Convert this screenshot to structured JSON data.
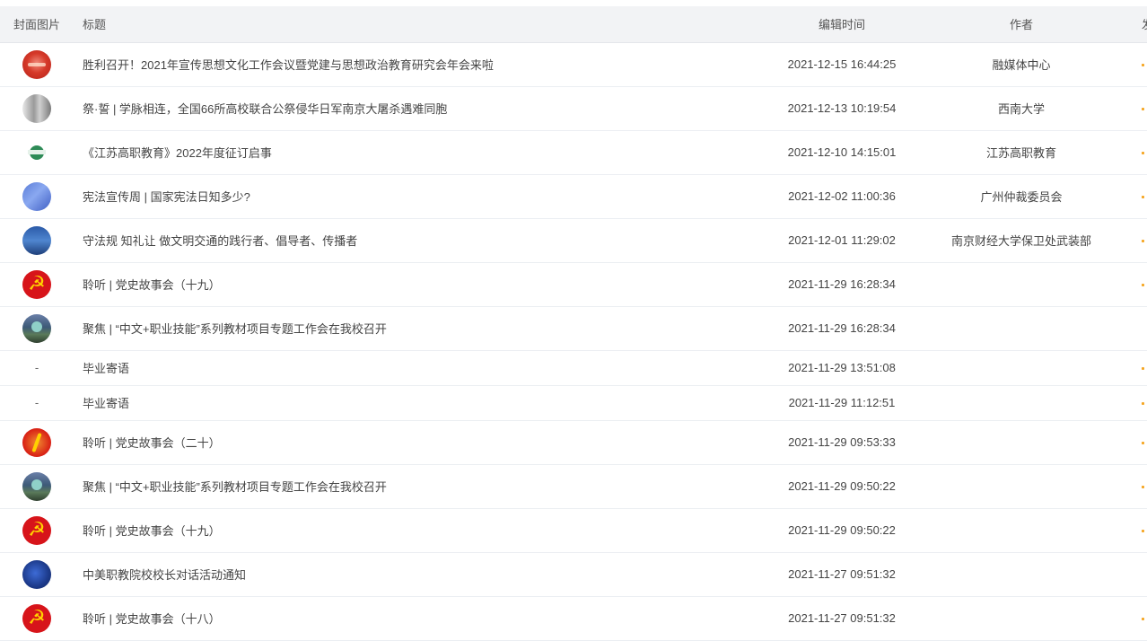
{
  "table": {
    "headers": {
      "cover": "封面图片",
      "title": "标题",
      "edit_time": "编辑时间",
      "author": "作者",
      "publish": "发"
    },
    "rows": [
      {
        "cover": "red-banner-thumbnail",
        "title": "胜利召开！2021年宣传思想文化工作会议暨党建与思想政治教育研究会年会来啦",
        "time": "2021-12-15 16:44:25",
        "author": "融媒体中心"
      },
      {
        "cover": "grayscale-photo-thumbnail",
        "title": "祭·誓 | 学脉相连，全国66所高校联合公祭侵华日军南京大屠杀遇难同胞",
        "time": "2021-12-13 10:19:54",
        "author": "西南大学"
      },
      {
        "cover": "green-logo-thumbnail",
        "title": "《江苏高职教育》2022年度征订启事",
        "time": "2021-12-10 14:15:01",
        "author": "江苏高职教育"
      },
      {
        "cover": "blue-graphic-thumbnail",
        "title": "宪法宣传周 | 国家宪法日知多少?",
        "time": "2021-12-02 11:00:36",
        "author": "广州仲裁委员会"
      },
      {
        "cover": "blue-photo-thumbnail",
        "title": "守法规 知礼让 做文明交通的践行者、倡导者、传播者",
        "time": "2021-12-01 11:29:02",
        "author": "南京财经大学保卫处武装部"
      },
      {
        "cover": "party-emblem-thumbnail",
        "title": "聆听 | 党史故事会（十九）",
        "time": "2021-11-29 16:28:34",
        "author": ""
      },
      {
        "cover": "scene-photo-thumbnail",
        "title": "聚焦 | “中文+职业技能”系列教材项目专题工作会在我校召开",
        "time": "2021-11-29 16:28:34",
        "author": ""
      },
      {
        "cover": "-",
        "title": "毕业寄语",
        "time": "2021-11-29 13:51:08",
        "author": ""
      },
      {
        "cover": "-",
        "title": "毕业寄语",
        "time": "2021-11-29 11:12:51",
        "author": ""
      },
      {
        "cover": "party-flag-thumbnail",
        "title": "聆听 | 党史故事会（二十）",
        "time": "2021-11-29 09:53:33",
        "author": ""
      },
      {
        "cover": "scene-photo-thumbnail",
        "title": "聚焦 | “中文+职业技能”系列教材项目专题工作会在我校召开",
        "time": "2021-11-29 09:50:22",
        "author": ""
      },
      {
        "cover": "party-emblem-thumbnail",
        "title": "聆听 | 党史故事会（十九）",
        "time": "2021-11-29 09:50:22",
        "author": ""
      },
      {
        "cover": "navy-graphic-thumbnail",
        "title": "中美职教院校校长对话活动通知",
        "time": "2021-11-27 09:51:32",
        "author": ""
      },
      {
        "cover": "party-emblem-thumbnail",
        "title": "聆听 | 党史故事会（十八）",
        "time": "2021-11-27 09:51:32",
        "author": ""
      }
    ]
  }
}
